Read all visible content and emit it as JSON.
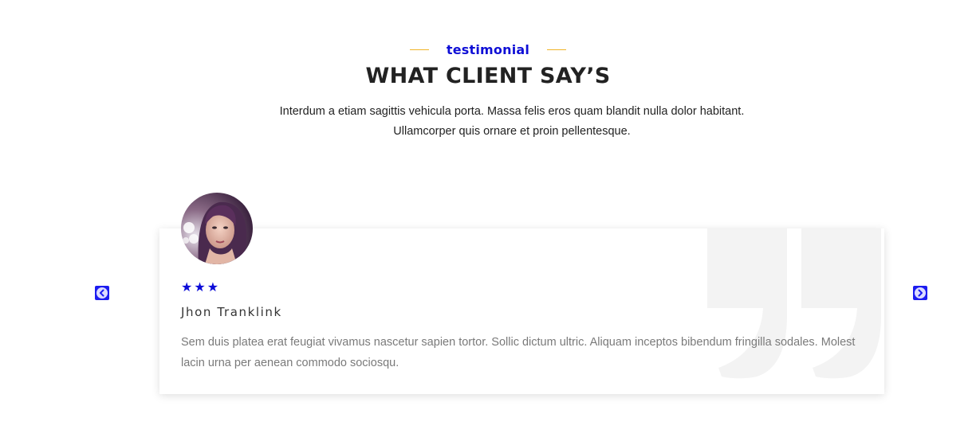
{
  "section": {
    "eyebrow": "testimonial",
    "title": "WHAT CLIENT SAY’S",
    "intro_line1": "Interdum a etiam sagittis vehicula porta. Massa felis eros quam blandit nulla dolor habitant.",
    "intro_line2": "Ullamcorper quis ornare et proin pellentesque."
  },
  "testimonial": {
    "rating": 3,
    "stars": [
      "★",
      "★",
      "★"
    ],
    "name": "Jhon Tranklink",
    "text": "Sem duis platea erat feugiat vivamus nascetur sapien tortor. Sollic dictum ultric. Aliquam inceptos bibendum fringilla sodales. Molest lacin urna per aenean commodo sociosqu.",
    "avatar_icon": "woman-portrait-photo",
    "quote_icon": "quote-mark-icon"
  },
  "navigation": {
    "prev_icon": "chevron-left-icon",
    "next_icon": "chevron-right-icon"
  },
  "colors": {
    "accent_blue": "#0f0fd6",
    "eyebrow_line": "#f0b429",
    "heading": "#222222",
    "body_text": "#7a7a7a",
    "quote_mark": "#f3f3f3"
  }
}
